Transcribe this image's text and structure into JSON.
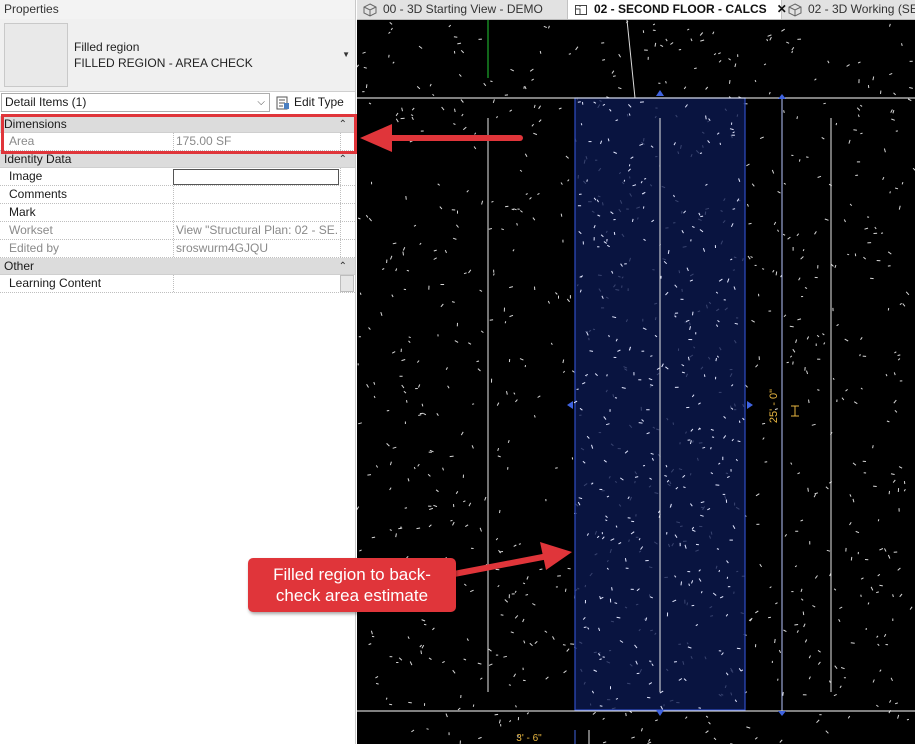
{
  "properties": {
    "title": "Properties",
    "type_family": "Filled region",
    "type_name": "FILLED REGION - AREA CHECK",
    "filter_label": "Detail Items (1)",
    "edit_type_label": "Edit Type",
    "groups": {
      "dimensions": {
        "label": "Dimensions",
        "rows": [
          {
            "key": "Area",
            "value": "175.00 SF"
          }
        ]
      },
      "identity": {
        "label": "Identity Data",
        "rows": [
          {
            "key": "Image",
            "value": ""
          },
          {
            "key": "Comments",
            "value": ""
          },
          {
            "key": "Mark",
            "value": ""
          },
          {
            "key": "Workset",
            "value": "View \"Structural Plan: 02 - SE..."
          },
          {
            "key": "Edited by",
            "value": "sroswurm4GJQU"
          }
        ]
      },
      "other": {
        "label": "Other",
        "rows": [
          {
            "key": "Learning Content",
            "value": ""
          }
        ]
      }
    }
  },
  "tabs": [
    {
      "label": "00 - 3D Starting View - DEMO",
      "icon": "3d-view-icon"
    },
    {
      "label": "02 - SECOND FLOOR - CALCS",
      "icon": "floor-plan-icon",
      "active": true
    },
    {
      "label": "02 - 3D Working (SE",
      "icon": "3d-view-icon"
    }
  ],
  "drawing": {
    "dim_vertical": "25' - 0\"",
    "dim_horizontal": "3' - 6\""
  },
  "annotation": {
    "callout_text": "Filled region to back-check area estimate",
    "color": "#e0353a"
  }
}
